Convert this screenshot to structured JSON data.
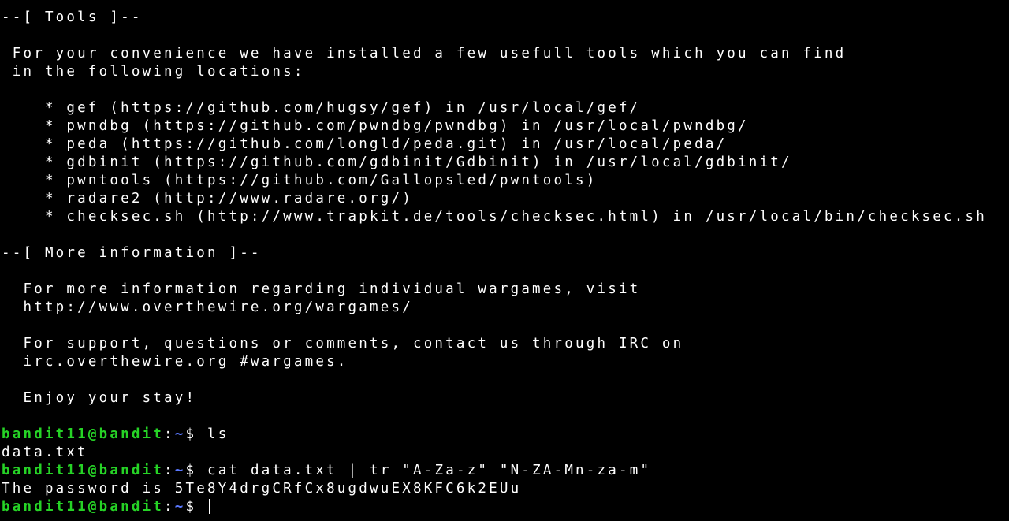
{
  "colors": {
    "background": "#000000",
    "text": "#ffffff",
    "prompt_user": "#26d326",
    "prompt_path": "#5a78ff"
  },
  "motd": [
    "--[ Tools ]--",
    "",
    " For your convenience we have installed a few usefull tools which you can find",
    " in the following locations:",
    "",
    "    * gef (https://github.com/hugsy/gef) in /usr/local/gef/",
    "    * pwndbg (https://github.com/pwndbg/pwndbg) in /usr/local/pwndbg/",
    "    * peda (https://github.com/longld/peda.git) in /usr/local/peda/",
    "    * gdbinit (https://github.com/gdbinit/Gdbinit) in /usr/local/gdbinit/",
    "    * pwntools (https://github.com/Gallopsled/pwntools)",
    "    * radare2 (http://www.radare.org/)",
    "    * checksec.sh (http://www.trapkit.de/tools/checksec.html) in /usr/local/bin/checksec.sh",
    "",
    "--[ More information ]--",
    "",
    "  For more information regarding individual wargames, visit",
    "  http://www.overthewire.org/wargames/",
    "",
    "  For support, questions or comments, contact us through IRC on",
    "  irc.overthewire.org #wargames.",
    "",
    "  Enjoy your stay!",
    ""
  ],
  "prompt": {
    "user_host": "bandit11@bandit",
    "colon": ":",
    "path": "~",
    "symbol": "$ "
  },
  "session": [
    {
      "command": "ls",
      "output": "data.txt"
    },
    {
      "command": "cat data.txt | tr \"A-Za-z\" \"N-ZA-Mn-za-m\"",
      "output": "The password is 5Te8Y4drgCRfCx8ugdwuEX8KFC6k2EUu"
    }
  ],
  "current_input": ""
}
